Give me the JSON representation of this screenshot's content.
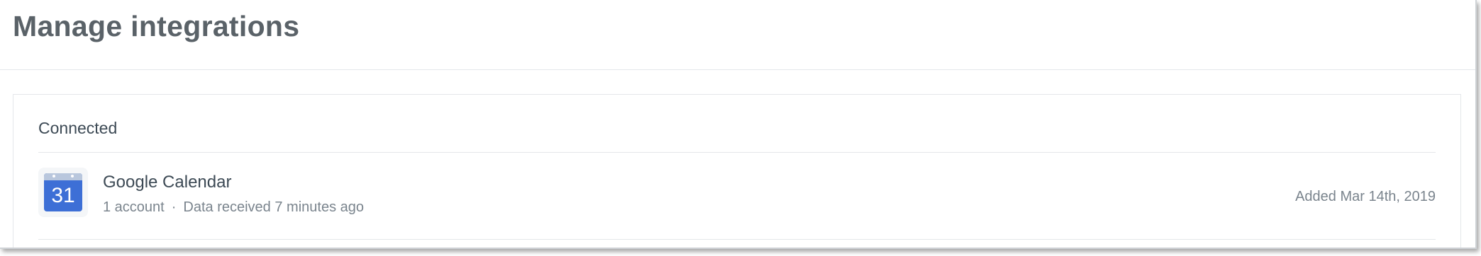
{
  "page": {
    "title": "Manage integrations"
  },
  "connected": {
    "section_title": "Connected",
    "items": [
      {
        "icon": "google-calendar-icon",
        "icon_day": "31",
        "name": "Google Calendar",
        "accounts": "1 account",
        "separator": "·",
        "status": "Data received 7 minutes ago",
        "added": "Added Mar 14th, 2019"
      }
    ]
  },
  "colors": {
    "title_text": "#5a6268",
    "body_text": "#3d4a55",
    "muted_text": "#7a848d",
    "calendar_blue": "#3d6fd6",
    "border": "#e4e7ea"
  }
}
